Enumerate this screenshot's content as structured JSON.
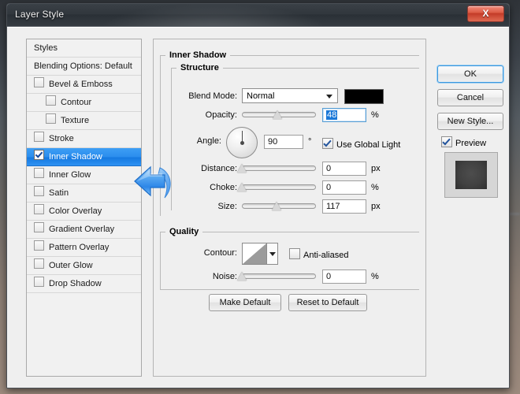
{
  "window": {
    "title": "Layer Style",
    "close_label": "X"
  },
  "styles_list": {
    "header_label": "Styles",
    "blending_options_label": "Blending Options: Default",
    "items": [
      {
        "label": "Bevel & Emboss",
        "checked": false,
        "indent": false,
        "selected": false
      },
      {
        "label": "Contour",
        "checked": false,
        "indent": true,
        "selected": false
      },
      {
        "label": "Texture",
        "checked": false,
        "indent": true,
        "selected": false
      },
      {
        "label": "Stroke",
        "checked": false,
        "indent": false,
        "selected": false
      },
      {
        "label": "Inner Shadow",
        "checked": true,
        "indent": false,
        "selected": true
      },
      {
        "label": "Inner Glow",
        "checked": false,
        "indent": false,
        "selected": false
      },
      {
        "label": "Satin",
        "checked": false,
        "indent": false,
        "selected": false
      },
      {
        "label": "Color Overlay",
        "checked": false,
        "indent": false,
        "selected": false
      },
      {
        "label": "Gradient Overlay",
        "checked": false,
        "indent": false,
        "selected": false
      },
      {
        "label": "Pattern Overlay",
        "checked": false,
        "indent": false,
        "selected": false
      },
      {
        "label": "Outer Glow",
        "checked": false,
        "indent": false,
        "selected": false
      },
      {
        "label": "Drop Shadow",
        "checked": false,
        "indent": false,
        "selected": false
      }
    ]
  },
  "main": {
    "group_title": "Inner Shadow",
    "structure": {
      "title": "Structure",
      "blend_mode_label": "Blend Mode:",
      "blend_mode_value": "Normal",
      "shadow_color": "#000000",
      "opacity_label": "Opacity:",
      "opacity_value": "48",
      "opacity_unit": "%",
      "opacity_percent": 48,
      "angle_label": "Angle:",
      "angle_value": "90",
      "angle_unit": "°",
      "use_global_light_label": "Use Global Light",
      "use_global_light_checked": true,
      "distance_label": "Distance:",
      "distance_value": "0",
      "distance_unit": "px",
      "distance_percent": 0,
      "choke_label": "Choke:",
      "choke_value": "0",
      "choke_unit": "%",
      "choke_percent": 0,
      "size_label": "Size:",
      "size_value": "117",
      "size_unit": "px",
      "size_percent": 47
    },
    "quality": {
      "title": "Quality",
      "contour_label": "Contour:",
      "anti_aliased_label": "Anti-aliased",
      "anti_aliased_checked": false,
      "noise_label": "Noise:",
      "noise_value": "0",
      "noise_unit": "%",
      "noise_percent": 0
    },
    "buttons": {
      "make_default": "Make Default",
      "reset_to_default": "Reset to Default"
    }
  },
  "right_column": {
    "ok_label": "OK",
    "cancel_label": "Cancel",
    "new_style_label": "New Style...",
    "preview_label": "Preview",
    "preview_checked": true
  },
  "colors": {
    "selection_blue": "#2b8ded",
    "focus_blue": "#3c97de",
    "annotation_arrow": "#2f8bef"
  }
}
